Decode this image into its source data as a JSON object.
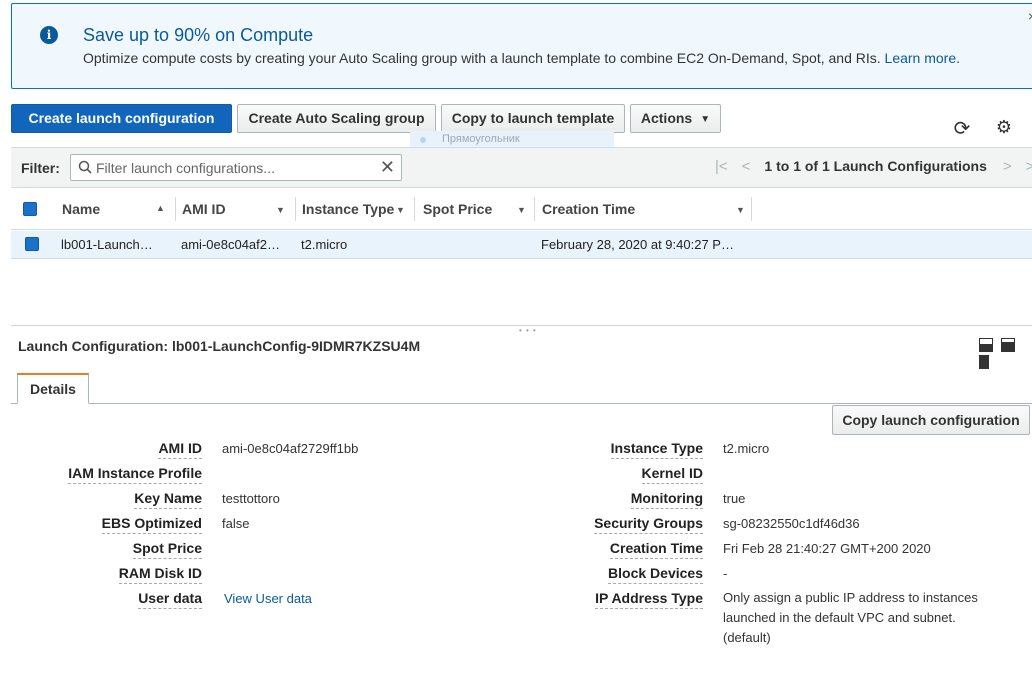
{
  "banner": {
    "title": "Save up to 90% on Compute",
    "message": "Optimize compute costs by creating your Auto Scaling group with a launch template to combine EC2 On-Demand, Spot, and RIs.",
    "link": "Learn more",
    "link_suffix": ".",
    "close": "×",
    "info_glyph": "i"
  },
  "toolbar": {
    "create_launch_configuration": "Create launch configuration",
    "create_auto_scaling_group": "Create Auto Scaling group",
    "copy_to_launch_template": "Copy to launch template",
    "actions": "Actions",
    "ghost_label": "Прямоугольник"
  },
  "filter": {
    "label": "Filter:",
    "placeholder": "Filter launch configurations...",
    "value": ""
  },
  "pager": {
    "summary": "1 to 1 of 1 Launch Configurations"
  },
  "table": {
    "columns": [
      "Name",
      "AMI ID",
      "Instance Type",
      "Spot Price",
      "Creation Time"
    ],
    "rows": [
      {
        "name": "lb001-Launch…",
        "ami_id": "ami-0e8c04af2…",
        "instance_type": "t2.micro",
        "spot_price": "",
        "creation_time": "February 28, 2020 at 9:40:27 P…"
      }
    ]
  },
  "details": {
    "title": "Launch Configuration: lb001-LaunchConfig-9IDMR7KZSU4M",
    "tab": "Details",
    "copy_button": "Copy launch configuration",
    "left": [
      {
        "label": "AMI ID",
        "value": "ami-0e8c04af2729ff1bb"
      },
      {
        "label": "IAM Instance Profile",
        "value": ""
      },
      {
        "label": "Key Name",
        "value": "testtottoro"
      },
      {
        "label": "EBS Optimized",
        "value": "false"
      },
      {
        "label": "Spot Price",
        "value": ""
      },
      {
        "label": "RAM Disk ID",
        "value": ""
      },
      {
        "label": "User data",
        "value": "View User data"
      }
    ],
    "right": [
      {
        "label": "Instance Type",
        "value": "t2.micro"
      },
      {
        "label": "Kernel ID",
        "value": ""
      },
      {
        "label": "Monitoring",
        "value": "true"
      },
      {
        "label": "Security Groups",
        "value": "sg-08232550c1df46d36"
      },
      {
        "label": "Creation Time",
        "value": "Fri Feb 28 21:40:27 GMT+200 2020"
      },
      {
        "label": "Block Devices",
        "value": "-"
      },
      {
        "label": "IP Address Type",
        "value": "Only assign a public IP address to instances launched in the default VPC and subnet. (default)"
      }
    ]
  },
  "colors": {
    "primary": "#1166bb",
    "link": "#0a5a99",
    "tab_accent": "#e67e22",
    "selected_row": "#e9f3fc"
  }
}
